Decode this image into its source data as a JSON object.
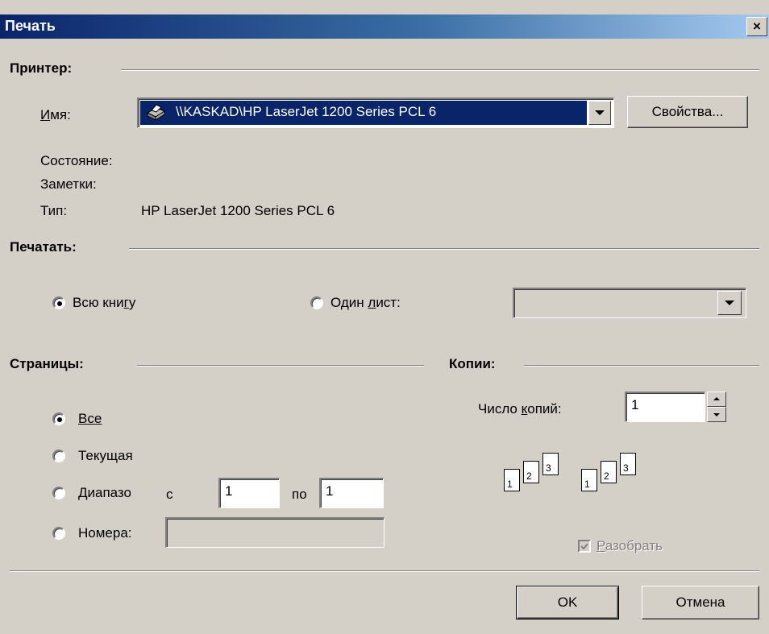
{
  "window": {
    "title": "Печать",
    "close_label": "×"
  },
  "printer": {
    "section_label": "Принтер:",
    "name_label": "Имя:",
    "name_value": "\\\\KASKAD\\HP LaserJet 1200 Series PCL 6",
    "properties_label": "Свойства...",
    "status_label": "Состояние:",
    "notes_label": "Заметки:",
    "type_label": "Тип:",
    "type_value": "HP LaserJet 1200 Series PCL 6"
  },
  "print_what": {
    "section_label": "Печатать:",
    "whole_book_label": "Всю книгу",
    "one_sheet_label": "Один лист:",
    "selected": "whole_book"
  },
  "pages": {
    "section_label": "Страницы:",
    "all_label": "Все",
    "current_label": "Текущая",
    "range_label": "Диапазо",
    "from_label": "с",
    "from_value": "1",
    "to_label": "по",
    "to_value": "1",
    "numbers_label": "Номера:",
    "numbers_value": "",
    "selected": "all"
  },
  "copies": {
    "section_label": "Копии:",
    "count_label": "Число копий:",
    "count_value": "1",
    "collate_label": "Разобрать",
    "collate_checked": true,
    "collate_icon": [
      "1",
      "2",
      "3"
    ]
  },
  "actions": {
    "ok_label": "OK",
    "cancel_label": "Отмена"
  }
}
